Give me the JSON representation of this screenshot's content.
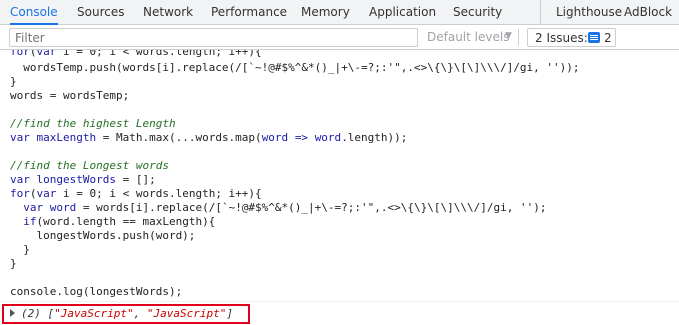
{
  "tabs": [
    {
      "label": "Console",
      "active": true
    },
    {
      "label": "Sources",
      "active": false
    },
    {
      "label": "Network",
      "active": false
    },
    {
      "label": "Performance",
      "active": false
    },
    {
      "label": "Memory",
      "active": false
    },
    {
      "label": "Application",
      "active": false
    },
    {
      "label": "Security",
      "active": false
    },
    {
      "label": "Lighthouse",
      "active": false
    },
    {
      "label": "AdBlock",
      "active": false
    }
  ],
  "filter": {
    "placeholder": "Filter",
    "levels_label": "Default levels",
    "issues_label": "2 Issues:",
    "issues_count": "2"
  },
  "code_lines": [
    "for(var i = 0; i < words.length; i++){",
    "  wordsTemp.push(words[i].replace(/[`~!@#$%^&*()_|+\\-=?;:'\",.<>\\{\\}\\[\\]\\\\\\/]/gi, ''));",
    "}",
    "words = wordsTemp;",
    "",
    "//find the highest Length",
    "var maxLength = Math.max(...words.map(word => word.length));",
    "",
    "//find the Longest words",
    "var longestWords = [];",
    "for(var i = 0; i < words.length; i++){",
    "  var word = words[i].replace(/[`~!@#$%^&*()_|+\\-=?;:'\",.<>\\{\\}\\[\\]\\\\\\/]/gi, '');",
    "  if(word.length == maxLength){",
    "    longestWords.push(word);",
    "  }",
    "}",
    "",
    "console.log(longestWords);"
  ],
  "output": {
    "count": "(2)",
    "items": [
      "\"JavaScript\"",
      "\"JavaScript\""
    ]
  },
  "colors": {
    "accent": "#1a73e8",
    "highlight": "#e0001b"
  }
}
